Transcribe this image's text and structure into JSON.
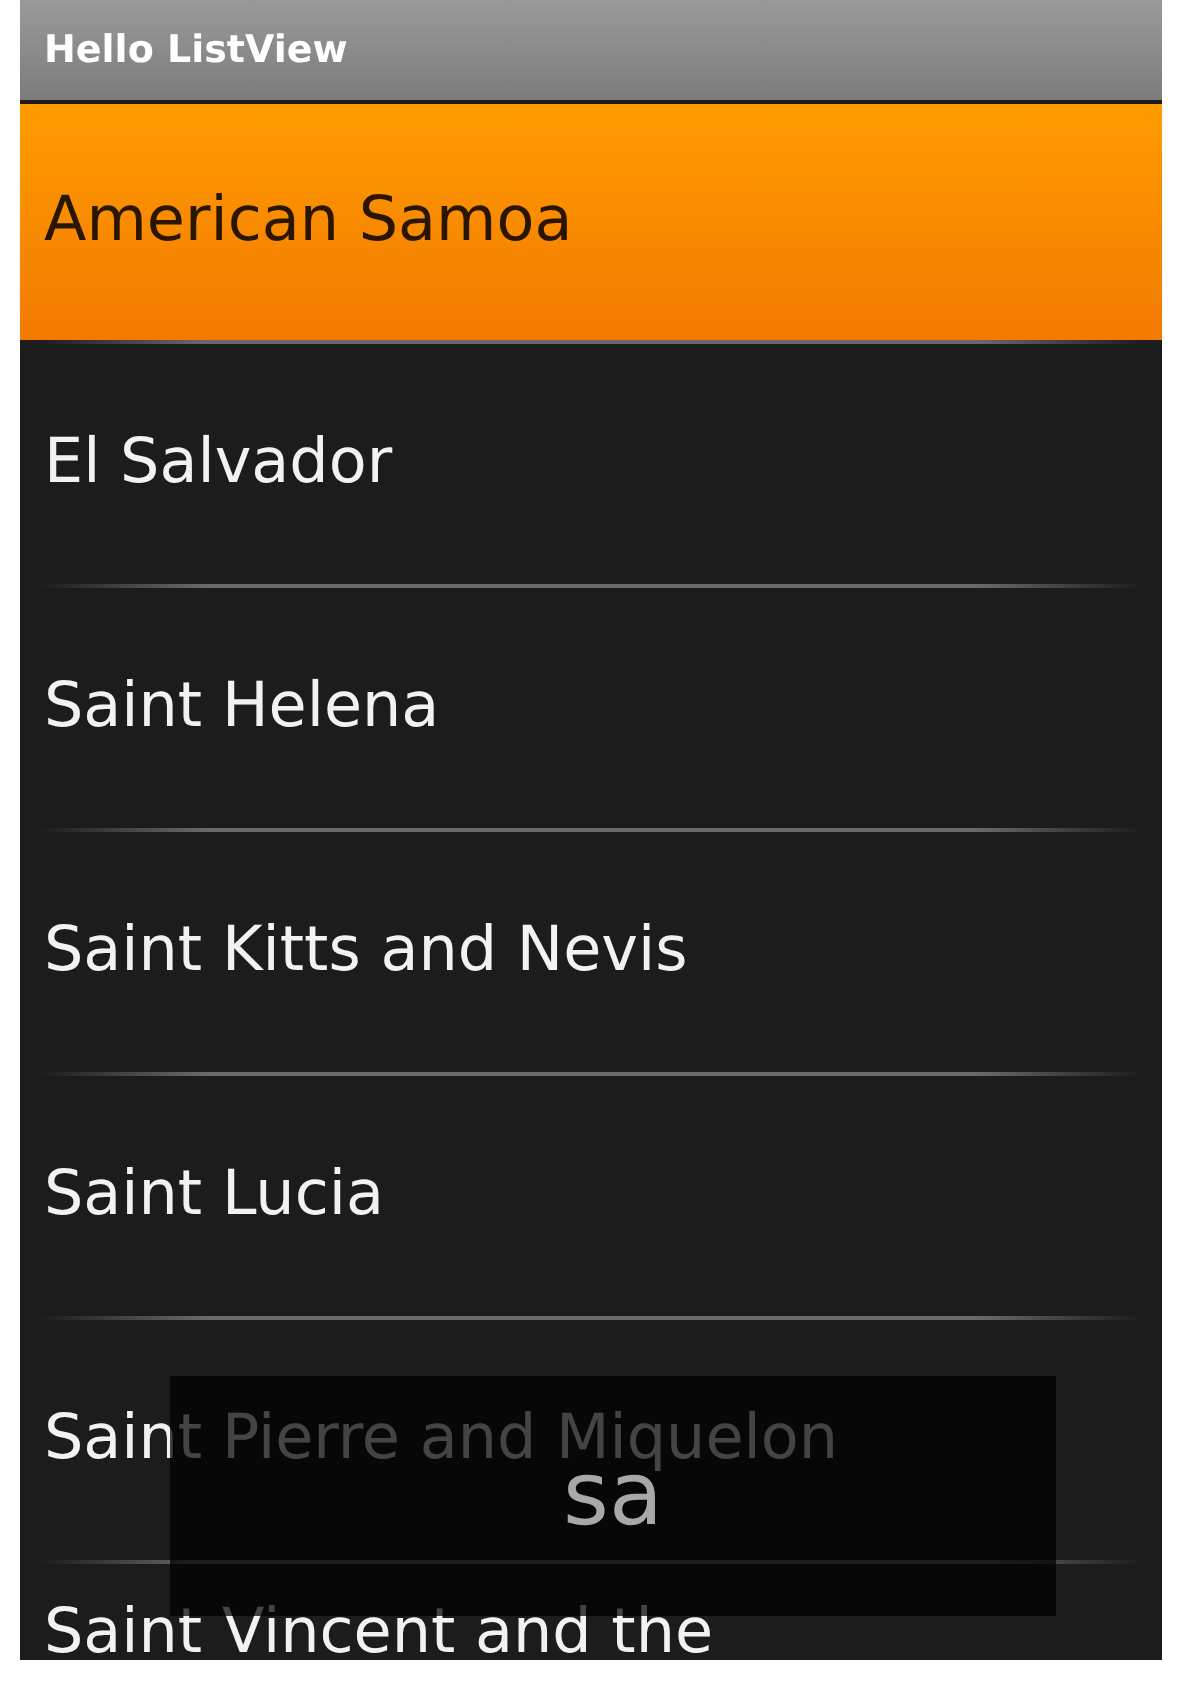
{
  "window": {
    "title": "Hello ListView"
  },
  "list": {
    "items": [
      {
        "label": "American Samoa",
        "selected": true
      },
      {
        "label": "El Salvador",
        "selected": false
      },
      {
        "label": "Saint Helena",
        "selected": false
      },
      {
        "label": "Saint Kitts and Nevis",
        "selected": false
      },
      {
        "label": "Saint Lucia",
        "selected": false
      },
      {
        "label": "Saint Pierre and Miquelon",
        "selected": false
      },
      {
        "label": "Saint Vincent and the",
        "selected": false
      }
    ]
  },
  "fast_scroll_overlay": {
    "text": "sa"
  }
}
